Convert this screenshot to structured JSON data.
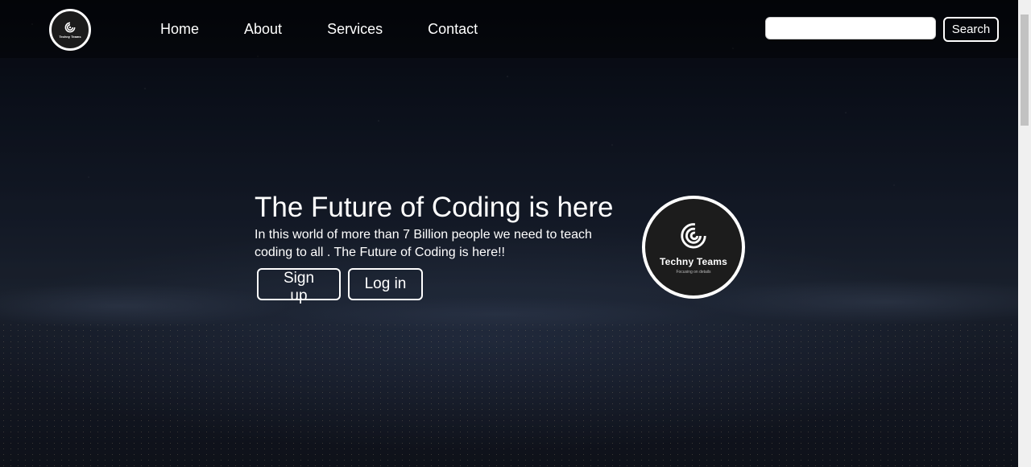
{
  "nav": {
    "logo_text": "Techny Teams",
    "links": [
      "Home",
      "About",
      "Services",
      "Contact"
    ]
  },
  "search": {
    "placeholder": "",
    "button_label": "Search"
  },
  "hero": {
    "title": "The Future of Coding is here",
    "text": "In this world of more than 7 Billion people we need to teach coding to all . The Future of Coding is here!!",
    "signup_label": "Sign up",
    "login_label": "Log in"
  },
  "brand": {
    "name": "Techny Teams",
    "tagline": "Focusing on details"
  },
  "colors": {
    "text": "#ffffff",
    "logo_bg": "#1c1c1c"
  }
}
